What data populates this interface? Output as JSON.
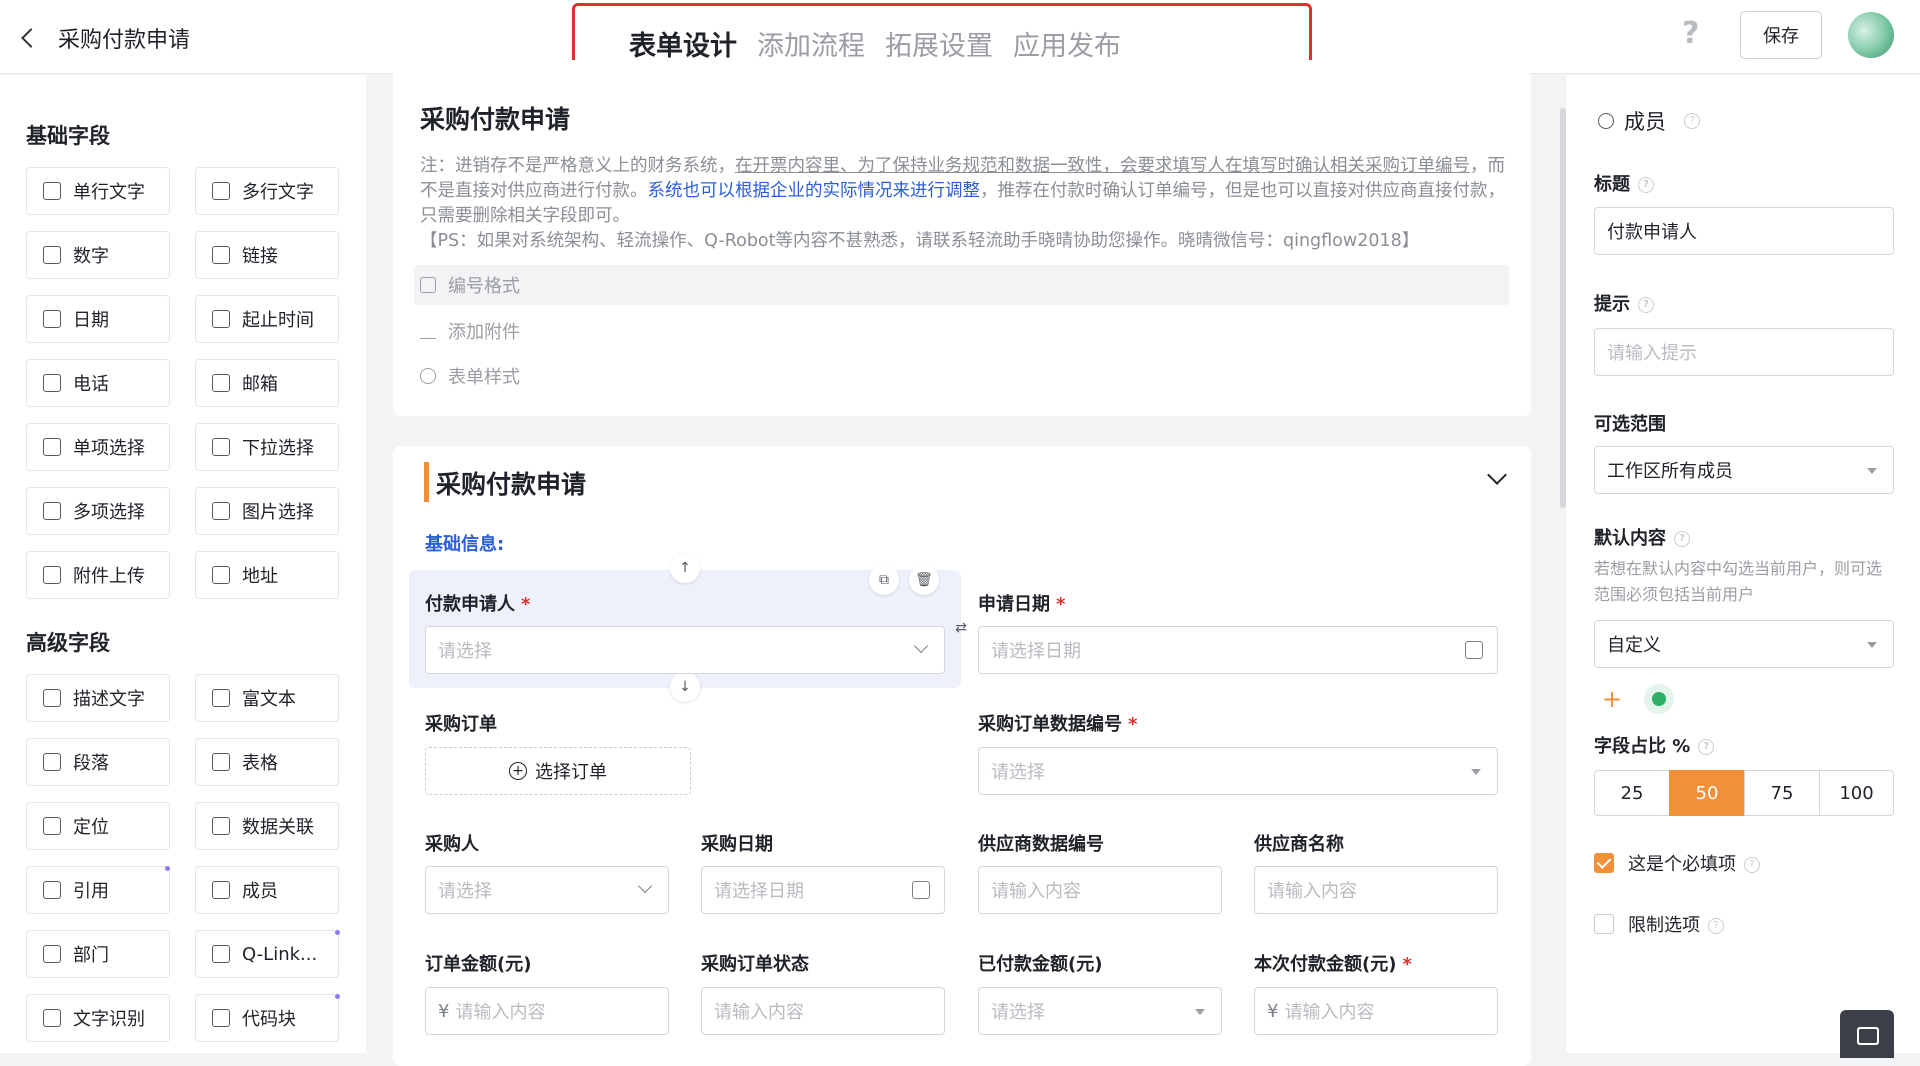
{
  "app": {
    "title": "采购付款申请",
    "save_label": "保存",
    "help": "?"
  },
  "tabs": [
    {
      "label": "表单设计",
      "active": true
    },
    {
      "label": "添加流程"
    },
    {
      "label": "拓展设置"
    },
    {
      "label": "应用发布"
    }
  ],
  "palette": {
    "basic_title": "基础字段",
    "basic": [
      {
        "label": "单行文字",
        "icon": "single-line-text-icon"
      },
      {
        "label": "多行文字",
        "icon": "multi-line-text-icon"
      },
      {
        "label": "数字",
        "icon": "number-icon"
      },
      {
        "label": "链接",
        "icon": "link-icon"
      },
      {
        "label": "日期",
        "icon": "date-icon"
      },
      {
        "label": "起止时间",
        "icon": "time-range-icon"
      },
      {
        "label": "电话",
        "icon": "phone-icon"
      },
      {
        "label": "邮箱",
        "icon": "email-icon"
      },
      {
        "label": "单项选择",
        "icon": "radio-icon"
      },
      {
        "label": "下拉选择",
        "icon": "dropdown-icon"
      },
      {
        "label": "多项选择",
        "icon": "checkbox-icon"
      },
      {
        "label": "图片选择",
        "icon": "image-select-icon"
      },
      {
        "label": "附件上传",
        "icon": "upload-icon"
      },
      {
        "label": "地址",
        "icon": "address-icon"
      }
    ],
    "advanced_title": "高级字段",
    "advanced": [
      {
        "label": "描述文字",
        "icon": "description-icon"
      },
      {
        "label": "富文本",
        "icon": "rich-text-icon"
      },
      {
        "label": "段落",
        "icon": "paragraph-icon"
      },
      {
        "label": "表格",
        "icon": "table-icon"
      },
      {
        "label": "定位",
        "icon": "location-icon"
      },
      {
        "label": "数据关联",
        "icon": "data-link-icon"
      },
      {
        "label": "引用",
        "icon": "reference-icon"
      },
      {
        "label": "成员",
        "icon": "member-icon"
      },
      {
        "label": "部门",
        "icon": "department-icon"
      },
      {
        "label": "Q-Link...",
        "icon": "q-link-icon"
      },
      {
        "label": "文字识别",
        "icon": "ocr-icon"
      },
      {
        "label": "代码块",
        "icon": "code-icon"
      }
    ]
  },
  "form_header": {
    "title": "采购付款申请",
    "note_1": "注：进销存不是严格意义上的财务系统，",
    "note_underlined": "在开票内容里、为了保持业务规范和数据一致性，会要求填写人在填写时确认相关采购订单编号",
    "note_2": "，而不是直接对供应商进行付款。",
    "note_blue": "系统也可以根据企业的实际情况来进行调整",
    "note_3": "，推荐在付款时确认订单编号，但是也可以直接对供应商直接付款，只需要删除相关字段即可。",
    "note_ps": "【PS：如果对系统架构、轻流操作、Q-Robot等内容不甚熟悉，请联系轻流助手晓晴协助您操作。晓晴微信号：qingflow2018】",
    "options": [
      "编号格式",
      "添加附件",
      "表单样式"
    ]
  },
  "section": {
    "title": "采购付款申请",
    "group_label": "基础信息:",
    "fields": {
      "applicant": {
        "label": "付款申请人",
        "placeholder": "请选择",
        "required": "*"
      },
      "apply_date": {
        "label": "申请日期",
        "placeholder": "请选择日期",
        "required": "*"
      },
      "purchase_order": {
        "label": "采购订单",
        "button": "选择订单"
      },
      "po_number": {
        "label": "采购订单数据编号",
        "placeholder": "请选择",
        "required": "*"
      },
      "buyer": {
        "label": "采购人",
        "placeholder": "请选择"
      },
      "purchase_date": {
        "label": "采购日期",
        "placeholder": "请选择日期"
      },
      "supplier_no": {
        "label": "供应商数据编号",
        "placeholder": "请输入内容"
      },
      "supplier_name": {
        "label": "供应商名称",
        "placeholder": "请输入内容"
      },
      "order_amount": {
        "label": "订单金额(元)",
        "placeholder": "请输入内容",
        "prefix": "¥"
      },
      "po_status": {
        "label": "采购订单状态",
        "placeholder": "请输入内容"
      },
      "paid_amount": {
        "label": "已付款金额(元)",
        "placeholder": "请选择"
      },
      "current_payment": {
        "label": "本次付款金额(元)",
        "placeholder": "请输入内容",
        "prefix": "¥",
        "required": "*"
      }
    }
  },
  "props": {
    "type": "成员",
    "title_label": "标题",
    "title_value": "付款申请人",
    "hint_label": "提示",
    "hint_placeholder": "请输入提示",
    "range_label": "可选范围",
    "range_value": "工作区所有成员",
    "default_label": "默认内容",
    "default_hint": "若想在默认内容中勾选当前用户，则可选范围必须包括当前用户",
    "default_value": "自定义",
    "width_label": "字段占比 %",
    "width_options": [
      "25",
      "50",
      "75",
      "100"
    ],
    "width_selected": "50",
    "required_label": "这是个必填项",
    "required_checked": true,
    "limit_label": "限制选项",
    "limit_checked": false
  },
  "colors": {
    "accent": "#f2903a",
    "link": "#2b5fd9",
    "highlight_box": "#e0312f",
    "selected_field_bg": "#eef0fb"
  }
}
